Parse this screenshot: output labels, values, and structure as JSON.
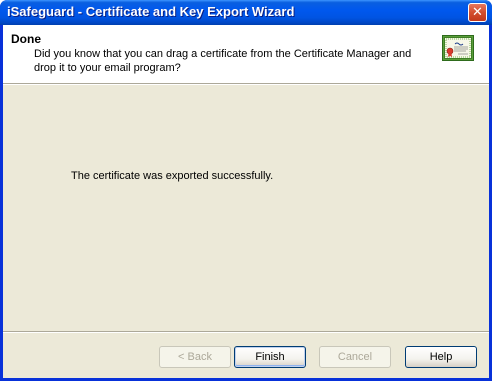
{
  "window": {
    "title": "iSafeguard - Certificate and Key Export Wizard",
    "close_symbol": "✕"
  },
  "header": {
    "title": "Done",
    "description": "Did you know that you can drag a certificate from the Certificate Manager and drop it to your email program?",
    "icon": "certificate-icon"
  },
  "main": {
    "message": "The certificate was exported successfully."
  },
  "buttons": {
    "back": "< Back",
    "finish": "Finish",
    "cancel": "Cancel",
    "help": "Help"
  },
  "colors": {
    "titlebar": "#0054e3",
    "client_background": "#ece9d8",
    "header_background": "#ffffff",
    "disabled_text": "#aca899"
  }
}
